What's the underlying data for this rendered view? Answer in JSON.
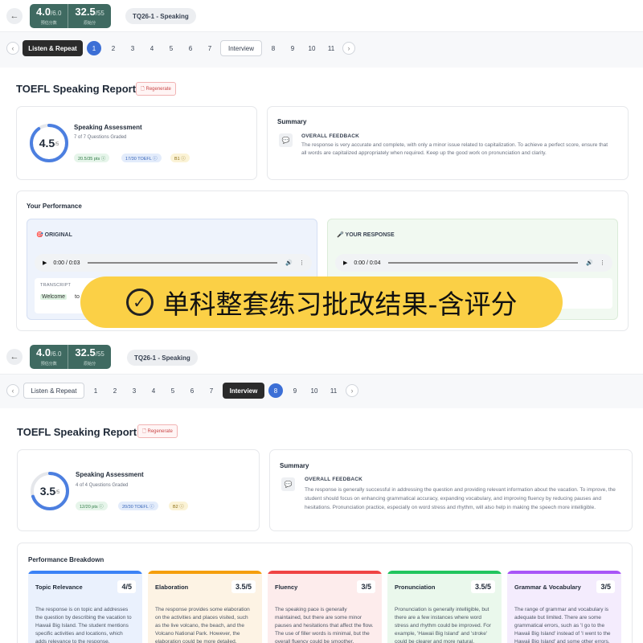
{
  "overlay": {
    "text": "单科整套练习批改结果-含评分"
  },
  "screen1": {
    "score1": {
      "value": "4.0",
      "max": "/6.0",
      "label": "预估分数"
    },
    "score2": {
      "value": "32.5",
      "max": "/55",
      "label": "原始分"
    },
    "test_name": "TQ26-1 - Speaking",
    "nav": {
      "prev": "‹",
      "next": "›",
      "section1": "Listen & Repeat",
      "section2": "Interview",
      "numbers_a": [
        "1",
        "2",
        "3",
        "4",
        "5",
        "6",
        "7"
      ],
      "numbers_b": [
        "8",
        "9",
        "10",
        "11"
      ],
      "active": "1"
    },
    "report_title": "TOEFL Speaking Report",
    "regen": "🗋 Regenerate",
    "assessment": {
      "score": "4.5",
      "max": "/5",
      "progress_pct": 90,
      "title": "Speaking Assessment",
      "subtitle": "7 of 7 Questions Graded",
      "badge_pts": "20.5/35 pts ⓘ",
      "badge_toefl": "17/30 TOEFL ⓘ",
      "badge_level": "B1 ⓘ"
    },
    "summary": {
      "title": "Summary",
      "icon": "💬",
      "label": "OVERALL FEEDBACK",
      "text": "The response is very accurate and complete, with only a minor issue related to capitalization. To achieve a perfect score, ensure that all words are capitalized appropriately when required. Keep up the good work on pronunciation and clarity."
    },
    "performance": {
      "title": "Your Performance",
      "original": {
        "icon": "🎯",
        "title": "ORIGINAL",
        "time": "0:00 / 0:03",
        "transcript_label": "TRANSCRIPT",
        "words": [
          "Welcome",
          "to"
        ]
      },
      "response": {
        "icon": "🎤",
        "title": "YOUR RESPONSE",
        "time": "0:00 / 0:04"
      }
    }
  },
  "screen2": {
    "score1": {
      "value": "4.0",
      "max": "/6.0",
      "label": "预估分数"
    },
    "score2": {
      "value": "32.5",
      "max": "/55",
      "label": "原始分"
    },
    "test_name": "TQ26-1 - Speaking",
    "nav": {
      "prev": "‹",
      "next": "›",
      "section1": "Listen & Repeat",
      "section2": "Interview",
      "numbers_a": [
        "1",
        "2",
        "3",
        "4",
        "5",
        "6",
        "7"
      ],
      "numbers_b": [
        "8",
        "9",
        "10",
        "11"
      ],
      "active": "8"
    },
    "report_title": "TOEFL Speaking Report",
    "regen": "🗋 Regenerate",
    "assessment": {
      "score": "3.5",
      "max": "/5",
      "progress_pct": 70,
      "title": "Speaking Assessment",
      "subtitle": "4 of 4 Questions Graded",
      "badge_pts": "12/20 pts ⓘ",
      "badge_toefl": "20/30 TOEFL ⓘ",
      "badge_level": "B2 ⓘ"
    },
    "summary": {
      "title": "Summary",
      "icon": "💬",
      "label": "OVERALL FEEDBACK",
      "text": "The response is generally successful in addressing the question and providing relevant information about the vacation. To improve, the student should focus on enhancing grammatical accuracy, expanding vocabulary, and improving fluency by reducing pauses and hesitations. Pronunciation practice, especially on word stress and rhythm, will also help in making the speech more intelligible."
    },
    "breakdown": {
      "title": "Performance Breakdown",
      "items": [
        {
          "name": "Topic Relevance",
          "score": "4/5",
          "color": "#3b82f6",
          "bg": "#eaf1fd",
          "text": "The response is on topic and addresses the question by describing the vacation to Hawaii Big Island. The student mentions specific activities and locations, which adds relevance to the response."
        },
        {
          "name": "Elaboration",
          "score": "3.5/5",
          "color": "#f59e0b",
          "bg": "#fdf3e4",
          "text": "The response provides some elaboration on the activities and places visited, such as the live volcano, the beach, and the Volcano National Park. However, the elaboration could be more detailed."
        },
        {
          "name": "Fluency",
          "score": "3/5",
          "color": "#ef4444",
          "bg": "#fdecec",
          "text": "The speaking pace is generally maintained, but there are some minor pauses and hesitations that affect the flow. The use of filler words is minimal, but the overall fluency could be smoother."
        },
        {
          "name": "Pronunciation",
          "score": "3.5/5",
          "color": "#22c55e",
          "bg": "#eaf8ec",
          "text": "Pronunciation is generally intelligible, but there are a few instances where word stress and rhythm could be improved. For example, 'Hawaii Big Island' and 'stroke' could be clearer and more natural."
        },
        {
          "name": "Grammar & Vocabulary",
          "score": "3/5",
          "color": "#a855f7",
          "bg": "#f4ecfd",
          "text": "The range of grammar and vocabulary is adequate but limited. There are some grammatical errors, such as 'I go to the Hawaii Big Island' instead of 'I went to the Hawaii Big Island' and some other errors."
        }
      ]
    }
  }
}
